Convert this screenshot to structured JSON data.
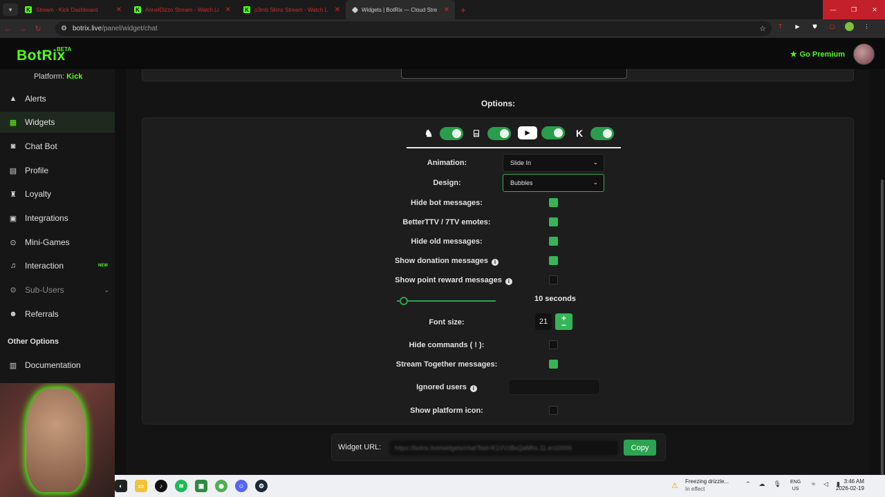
{
  "browser": {
    "tabs": [
      {
        "title": "Stream - Kick Dashboard",
        "fav": "K",
        "active": false
      },
      {
        "title": "AnnelDizzo Stream - Watch Li",
        "fav": "K",
        "active": false
      },
      {
        "title": "p3mb Skins Stream - Watch L",
        "fav": "K",
        "active": false
      },
      {
        "title": "Widgets | BotRix — Cloud Stre",
        "fav": "",
        "active": true
      }
    ],
    "new_tab": "+",
    "url_host": "botrix.live",
    "url_path": "/panel/widget/chat"
  },
  "header": {
    "logo": "BotRix",
    "beta": "BETA",
    "premium_label": "Go Premium"
  },
  "sidebar": {
    "platform_label": "Platform:",
    "platform_value": "Kick",
    "items": [
      {
        "label": "Alerts",
        "icon": "warning-icon"
      },
      {
        "label": "Widgets",
        "icon": "grid-icon",
        "active": true
      },
      {
        "label": "Chat Bot",
        "icon": "robot-icon"
      },
      {
        "label": "Profile",
        "icon": "id-card-icon"
      },
      {
        "label": "Loyalty",
        "icon": "trophy-icon"
      },
      {
        "label": "Integrations",
        "icon": "puzzle-icon"
      },
      {
        "label": "Mini-Games",
        "icon": "gamepad-icon"
      },
      {
        "label": "Interaction",
        "icon": "music-icon",
        "badge": "NEW"
      },
      {
        "label": "Sub-Users",
        "icon": "users-icon",
        "muted": true
      },
      {
        "label": "Referrals",
        "icon": "people-icon"
      }
    ],
    "other_heading": "Other Options",
    "documentation": "Documentation"
  },
  "main": {
    "options_title": "Options:",
    "animation_label": "Animation:",
    "animation_value": "Slide In",
    "design_label": "Design:",
    "design_value": "Bubbles",
    "hide_bot_label": "Hide bot messages:",
    "hide_bot": true,
    "bttv_label": "BetterTTV / 7TV emotes:",
    "bttv": true,
    "hide_old_label": "Hide old messages:",
    "hide_old": true,
    "donation_label": "Show donation messages",
    "donation": true,
    "point_reward_label": "Show point reward messages",
    "point_reward": false,
    "slider_value": "10 seconds",
    "font_size_label": "Font size:",
    "font_size": "21",
    "hide_commands_label": "Hide commands ( ! ):",
    "hide_commands": false,
    "stream_together_label": "Stream Together messages:",
    "stream_together": true,
    "ignored_users_label": "Ignored users",
    "platform_icon_label": "Show platform icon:",
    "platform_icon": false,
    "widget_url_label": "Widget URL:",
    "widget_url": "https://botrix.live/widgets/chat?bid=K1VVzBxQaMhs.11.en10006",
    "copy_label": "Copy"
  },
  "taskbar": {
    "weather_title": "Freezing drizzle...",
    "weather_sub": "In effect",
    "lang_1": "ENG",
    "lang_2": "US",
    "time": "3:46 AM",
    "date": "2026-02-19"
  },
  "colors": {
    "accent": "#53fc18",
    "toggle_green": "#35b558",
    "background": "#141414"
  }
}
